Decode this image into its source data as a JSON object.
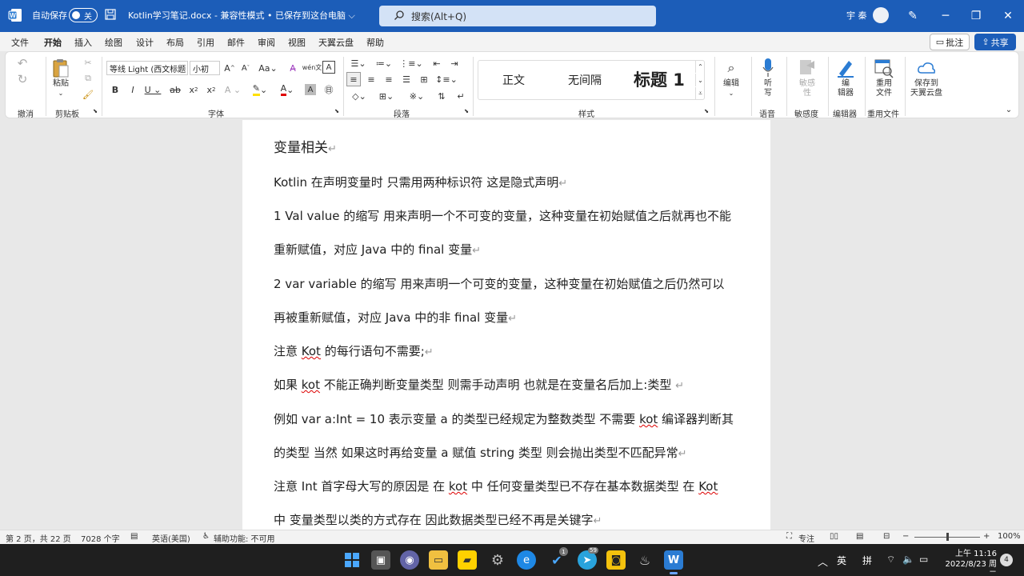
{
  "titlebar": {
    "autosave_label": "自动保存",
    "autosave_state": "关",
    "document_title": "Kotlin学习笔记.docx  -  兼容性模式 • 已保存到这台电脑 ⌵",
    "search_placeholder": "搜索(Alt+Q)",
    "user_name": "宇 秦",
    "icons": [
      "word-app-icon",
      "save-icon",
      "search-icon",
      "pen-icon",
      "minimize-icon",
      "maximize-icon",
      "close-icon"
    ]
  },
  "menu": {
    "items": [
      "文件",
      "开始",
      "插入",
      "绘图",
      "设计",
      "布局",
      "引用",
      "邮件",
      "审阅",
      "视图",
      "天翼云盘",
      "帮助"
    ],
    "active": "开始",
    "comment_label": "批注",
    "share_label": "共享"
  },
  "ribbon": {
    "groups": {
      "undo": "撤消",
      "clipboard": "剪贴板",
      "font": "字体",
      "paragraph": "段落",
      "styles": "样式",
      "voice": "语音",
      "sensitivity": "敏感度",
      "editor": "编辑器",
      "reuse": "重用文件"
    },
    "paste_label": "粘贴",
    "font_name": "等线 Light (西文标题",
    "font_size": "小初",
    "styles": [
      "正文",
      "无间隔",
      "标题 1"
    ],
    "editing_label": "编辑",
    "dictate_label": "听\n写",
    "dictate_line1": "听",
    "dictate_line2": "写",
    "sensitivity_line1": "敏感",
    "sensitivity_line2": "性",
    "editor_line1": "编",
    "editor_line2": "辑器",
    "reuse_line1": "重用",
    "reuse_line2": "文件",
    "tianyi_line1": "保存到",
    "tianyi_line2": "天翼云盘"
  },
  "document": {
    "heading": "变量相关",
    "paragraphs": {
      "p1": "Kotlin 在声明变量时  只需用两种标识符 这是隐式声明",
      "p2a": "1 Val value 的缩写  用来声明一个不可变的变量，这种变量在初始赋值之后就再也不能",
      "p2b": "重新赋值，对应 Java 中的 final 变量",
      "p3a": "2  var  variable 的缩写  用来声明一个可变的变量，这种变量在初始赋值之后仍然可以",
      "p3b": "再被重新赋值，对应 Java 中的非 final 变量",
      "p4_pre": "注意 ",
      "p4_kot": "Kot",
      "p4_post": " 的每行语句不需要;",
      "p5_pre": "如果 ",
      "p5_kot": "kot",
      "p5_post": " 不能正确判断变量类型 则需手动声明 也就是在变量名后加上:类型 ",
      "p6a_pre": "例如  var  a:Int  =  10 表示变量 a 的类型已经规定为整数类型  不需要 ",
      "p6a_kot": "kot",
      "p6a_post": " 编译器判断其",
      "p6b": "的类型 当然 如果这时再给变量 a 赋值 string 类型  则会抛出类型不匹配异常",
      "p7a_pre": "注意  Int 首字母大写的原因是  在 ",
      "p7a_kot": "kot",
      "p7a_mid": " 中  任何变量类型已不存在基本数据类型  在 ",
      "p7a_Kot": "Kot",
      "p7b": "中 变量类型以类的方式存在 因此数据类型已经不再是关键字"
    },
    "paragraph_mark": "↵"
  },
  "statusbar": {
    "page": "第 2 页，共 22 页",
    "words": "7028 个字",
    "language": "英语(美国)",
    "accessibility": "辅助功能: 不可用",
    "focus": "专注",
    "zoom": "100%",
    "zoom_level": 1.0
  },
  "taskbar": {
    "ime_lang": "英",
    "ime_mode": "拼",
    "time": "上午 11:16",
    "date": "2022/8/23 周二",
    "notifications": "4",
    "badge_checklist": "1",
    "badge_telegram": "59"
  }
}
